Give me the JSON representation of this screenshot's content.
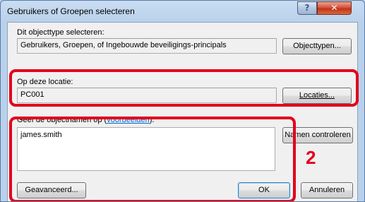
{
  "window": {
    "title": "Gebruikers of Groepen selecteren",
    "help_label": "?",
    "close_label": "✕"
  },
  "object_type": {
    "label": "Dit objecttype selecteren:",
    "value": "Gebruikers, Groepen, of Ingebouwde beveiligings-principals",
    "button_label": "Objecttypen..."
  },
  "location": {
    "label": "Op deze locatie:",
    "value": "PC001",
    "button_label": "Locaties..."
  },
  "object_names": {
    "label_prefix": "Geef de objectnamen op (",
    "label_link": "voorbeelden",
    "label_suffix": "):",
    "value": "james.smith",
    "check_button_label": "Namen controleren"
  },
  "footer": {
    "advanced_label": "Geavanceerd...",
    "ok_label": "OK",
    "cancel_label": "Annuleren"
  },
  "annotation": {
    "step_number": "2",
    "highlight_color": "#e3001b"
  }
}
